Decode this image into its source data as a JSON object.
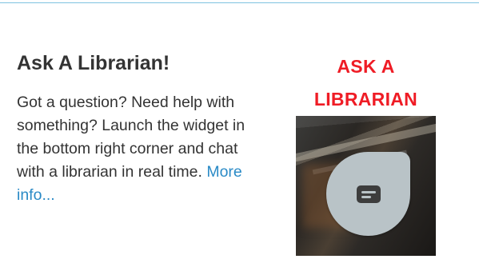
{
  "widget": {
    "heading": "Ask A Librarian!",
    "body_text": "Got a question? Need help with something? Launch the widget in the bottom right corner and chat with a librarian in real time. ",
    "more_link": "More info...",
    "promo": {
      "title_line1": "ASK A",
      "title_line2": "LIBRARIAN",
      "chat_icon": "chat-message-icon"
    }
  },
  "colors": {
    "heading": "#333333",
    "link": "#2a8ac6",
    "promo_title": "#ef1c25",
    "rule": "#7fc3e0",
    "chat_bubble": "#b9c3c7",
    "chat_icon": "#3d3d3d"
  }
}
